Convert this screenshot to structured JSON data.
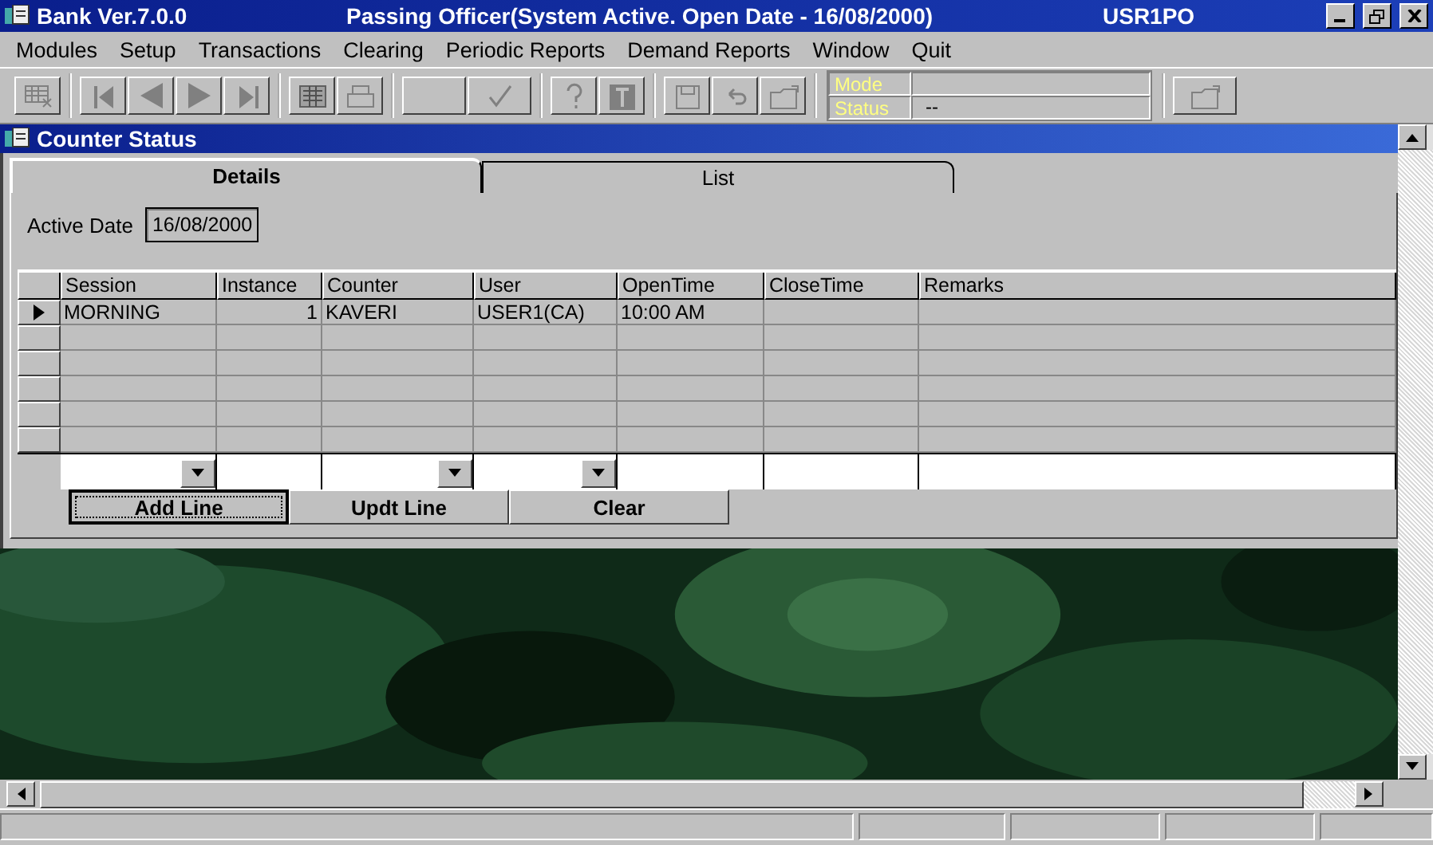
{
  "window": {
    "title": "Bank Ver.7.0.0",
    "context": "Passing Officer(System Active. Open Date - 16/08/2000)",
    "user": "USR1PO"
  },
  "menu": [
    "Modules",
    "Setup",
    "Transactions",
    "Clearing",
    "Periodic Reports",
    "Demand Reports",
    "Window",
    "Quit"
  ],
  "toolbar": {
    "groups": [
      [
        {
          "kind": "edit-grid"
        }
      ],
      [
        {
          "kind": "first"
        },
        {
          "kind": "prev"
        },
        {
          "kind": "next"
        },
        {
          "kind": "last"
        }
      ],
      [
        {
          "kind": "calculator"
        },
        {
          "kind": "print"
        }
      ],
      [
        {
          "kind": "blank"
        },
        {
          "kind": "check"
        }
      ],
      [
        {
          "kind": "help"
        },
        {
          "kind": "text"
        }
      ],
      [
        {
          "kind": "save"
        },
        {
          "kind": "undo"
        },
        {
          "kind": "folder"
        }
      ]
    ],
    "mode_label": "Mode",
    "status_label": "Status",
    "status_value": "--",
    "end_button": {
      "kind": "folder"
    }
  },
  "child": {
    "title": "Counter Status",
    "tabs": [
      {
        "label": "Details",
        "selected": true
      },
      {
        "label": "List",
        "selected": false
      }
    ],
    "active_date": {
      "label": "Active Date",
      "value": "16/08/2000"
    },
    "table": {
      "columns": [
        "Session",
        "Instance",
        "Counter",
        "User",
        "OpenTime",
        "CloseTime",
        "Remarks"
      ],
      "rows": [
        {
          "current": true,
          "cells": [
            "MORNING",
            "1",
            "KAVERI",
            "USER1(CA)",
            "10:00 AM"
          ]
        }
      ],
      "entry": [
        {
          "kind": "combo"
        },
        {
          "kind": "text"
        },
        {
          "kind": "combo"
        },
        {
          "kind": "combo"
        },
        {
          "kind": "text"
        },
        {
          "kind": "text"
        },
        {
          "kind": "text"
        }
      ]
    },
    "buttons": [
      {
        "label": "Add Line",
        "focused": true
      },
      {
        "label": "Updt Line",
        "focused": false
      },
      {
        "label": "Clear",
        "focused": false
      }
    ]
  }
}
